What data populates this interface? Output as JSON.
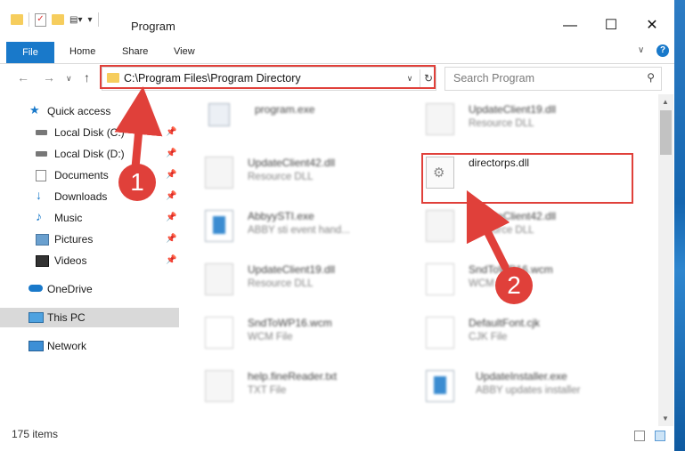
{
  "window": {
    "title": "Program"
  },
  "ribbon": {
    "tabs": [
      "File",
      "Home",
      "Share",
      "View"
    ]
  },
  "nav": {
    "address": "C:\\Program Files\\Program Directory",
    "search_placeholder": "Search Program"
  },
  "sidebar": {
    "items": [
      {
        "label": "Quick access",
        "icon": "star-icon"
      },
      {
        "label": "Local Disk (C:)",
        "icon": "drive-icon",
        "pinned": true
      },
      {
        "label": "Local Disk (D:)",
        "icon": "drive-icon",
        "pinned": true
      },
      {
        "label": "Documents",
        "icon": "documents-icon",
        "pinned": true
      },
      {
        "label": "Downloads",
        "icon": "download-icon",
        "pinned": true
      },
      {
        "label": "Music",
        "icon": "music-icon",
        "pinned": true
      },
      {
        "label": "Pictures",
        "icon": "pictures-icon",
        "pinned": true
      },
      {
        "label": "Videos",
        "icon": "videos-icon",
        "pinned": true
      },
      {
        "label": "OneDrive",
        "icon": "cloud-icon"
      },
      {
        "label": "This PC",
        "icon": "computer-icon",
        "selected": true
      },
      {
        "label": "Network",
        "icon": "network-icon"
      }
    ]
  },
  "files": [
    {
      "name": "program.exe",
      "type": ""
    },
    {
      "name": "UpdateClient19.dll",
      "type": "Resource DLL"
    },
    {
      "name": "UpdateClient42.dll",
      "type": "Resource DLL"
    },
    {
      "name": "directorps.dll",
      "type": ""
    },
    {
      "name": "AbbyySTI.exe",
      "type": "ABBY sti event hand..."
    },
    {
      "name": "UpdateClient42.dll",
      "type": "Resource DLL"
    },
    {
      "name": "UpdateClient19.dll",
      "type": "Resource DLL"
    },
    {
      "name": "SndToWP16.wcm",
      "type": "WCM File"
    },
    {
      "name": "SndToWP16.wcm",
      "type": "WCM File"
    },
    {
      "name": "DefaultFont.cjk",
      "type": "CJK File"
    },
    {
      "name": "help.fineReader.txt",
      "type": "TXT File"
    },
    {
      "name": "UpdateInstaller.exe",
      "type": "ABBY updates installer"
    }
  ],
  "status": {
    "item_count": "175 items"
  },
  "annotations": {
    "step1": "1",
    "step2": "2"
  },
  "colors": {
    "accent": "#1979ca",
    "highlight": "#e0403a"
  }
}
